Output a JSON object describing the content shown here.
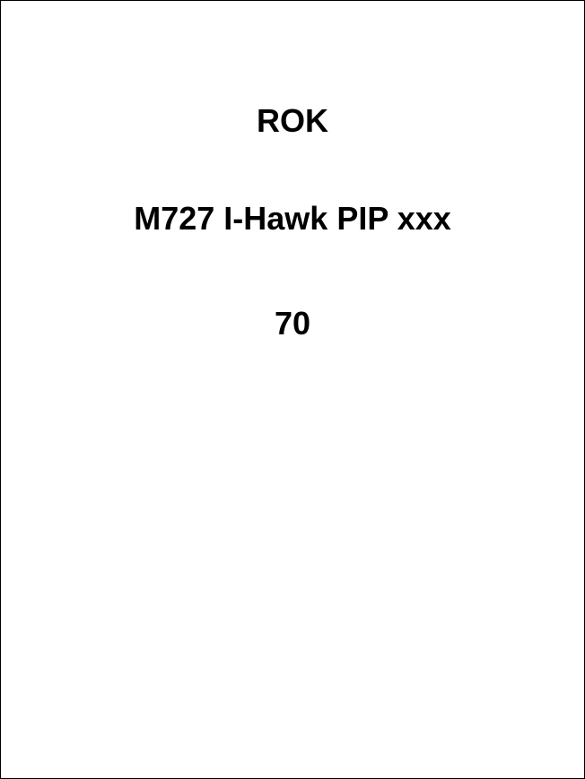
{
  "document": {
    "lines": [
      "ROK",
      "M727 I-Hawk PIP xxx",
      "70"
    ]
  }
}
